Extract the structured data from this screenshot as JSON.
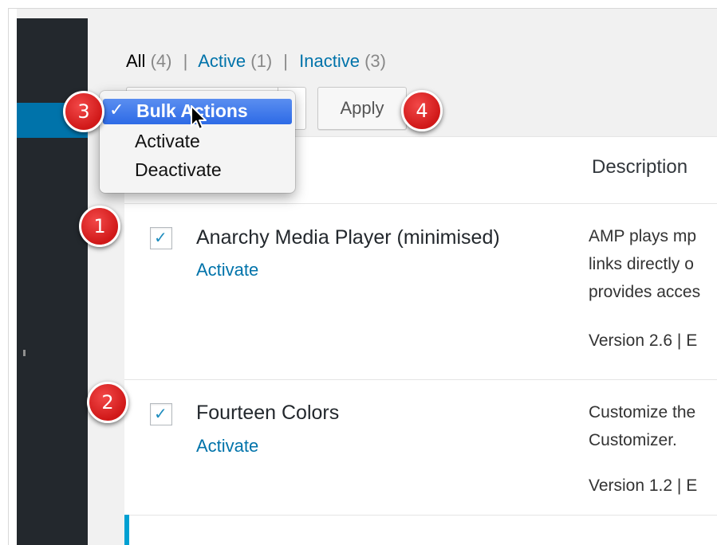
{
  "filters": {
    "all": {
      "label": "All",
      "count": "(4)"
    },
    "active": {
      "label": "Active",
      "count": "(1)"
    },
    "inactive": {
      "label": "Inactive",
      "count": "(3)"
    },
    "separator": "|"
  },
  "bulk_actions": {
    "selected_label": "Bulk Actions",
    "selected_check": "✓",
    "options": [
      "Activate",
      "Deactivate"
    ],
    "apply_label": "Apply"
  },
  "table": {
    "description_header": "Description",
    "rows": [
      {
        "name": "Anarchy Media Player (minimised)",
        "action": "Activate",
        "checked": "✓",
        "description": [
          "AMP plays mp",
          "links directly o",
          "provides acces"
        ],
        "version": "Version 2.6 | E"
      },
      {
        "name": "Fourteen Colors",
        "action": "Activate",
        "checked": "✓",
        "description": [
          "Customize the",
          "Customizer."
        ],
        "version": "Version 1.2 | E"
      }
    ]
  },
  "badges": [
    "1",
    "2",
    "3",
    "4"
  ],
  "colors": {
    "admin_sidebar": "#23282d",
    "admin_blue": "#0073aa",
    "menu_highlight": "#2d6ae6",
    "badge_red": "#d01818"
  }
}
